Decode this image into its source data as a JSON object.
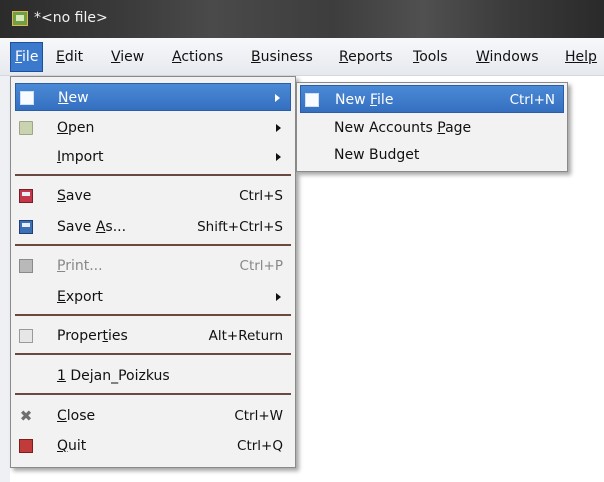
{
  "window": {
    "title": "*<no file>"
  },
  "menubar": {
    "items": [
      {
        "label": "File",
        "accel": "F",
        "rest": "ile"
      },
      {
        "label": "Edit",
        "accel": "E",
        "rest": "dit"
      },
      {
        "label": "View",
        "accel": "V",
        "rest": "iew"
      },
      {
        "label": "Actions",
        "accel": "A",
        "rest": "ctions"
      },
      {
        "label": "Business",
        "accel": "B",
        "rest": "usiness"
      },
      {
        "label": "Reports",
        "accel": "R",
        "rest": "eports"
      },
      {
        "label": "Tools",
        "accel": "T",
        "rest": "ools"
      },
      {
        "label": "Windows",
        "accel": "W",
        "rest": "indows"
      },
      {
        "label": "Help",
        "accel": "",
        "rest": "Help"
      }
    ]
  },
  "file_menu": {
    "new": {
      "pre": "",
      "accel": "N",
      "post": "ew"
    },
    "open": {
      "pre": "",
      "accel": "O",
      "post": "pen"
    },
    "import": {
      "pre": "",
      "accel": "I",
      "post": "mport"
    },
    "save": {
      "pre": "",
      "accel": "S",
      "post": "ave",
      "shortcut": "Ctrl+S"
    },
    "save_as": {
      "pre": "Save ",
      "accel": "A",
      "post": "s...",
      "shortcut": "Shift+Ctrl+S"
    },
    "print": {
      "pre": "",
      "accel": "P",
      "post": "rint...",
      "shortcut": "Ctrl+P"
    },
    "export": {
      "pre": "",
      "accel": "E",
      "post": "xport"
    },
    "properties": {
      "pre": "Proper",
      "accel": "t",
      "post": "ies",
      "shortcut": "Alt+Return"
    },
    "recent_1": {
      "pre": "",
      "accel": "1",
      "post": " Dejan_Poizkus"
    },
    "close": {
      "pre": "",
      "accel": "C",
      "post": "lose",
      "shortcut": "Ctrl+W"
    },
    "quit": {
      "pre": "",
      "accel": "Q",
      "post": "uit",
      "shortcut": "Ctrl+Q"
    }
  },
  "new_submenu": {
    "new_file": {
      "pre": "New ",
      "accel": "F",
      "post": "ile",
      "shortcut": "Ctrl+N"
    },
    "new_accounts_page": {
      "pre": "New Accounts ",
      "accel": "P",
      "post": "age"
    },
    "new_budget": {
      "pre": "New Budget",
      "accel": "",
      "post": ""
    }
  },
  "colors": {
    "highlight": "#3b79cc",
    "titlebar": "#3a3a3a",
    "menu_bg": "#f2f2f2",
    "separator": "#6a4a40"
  }
}
